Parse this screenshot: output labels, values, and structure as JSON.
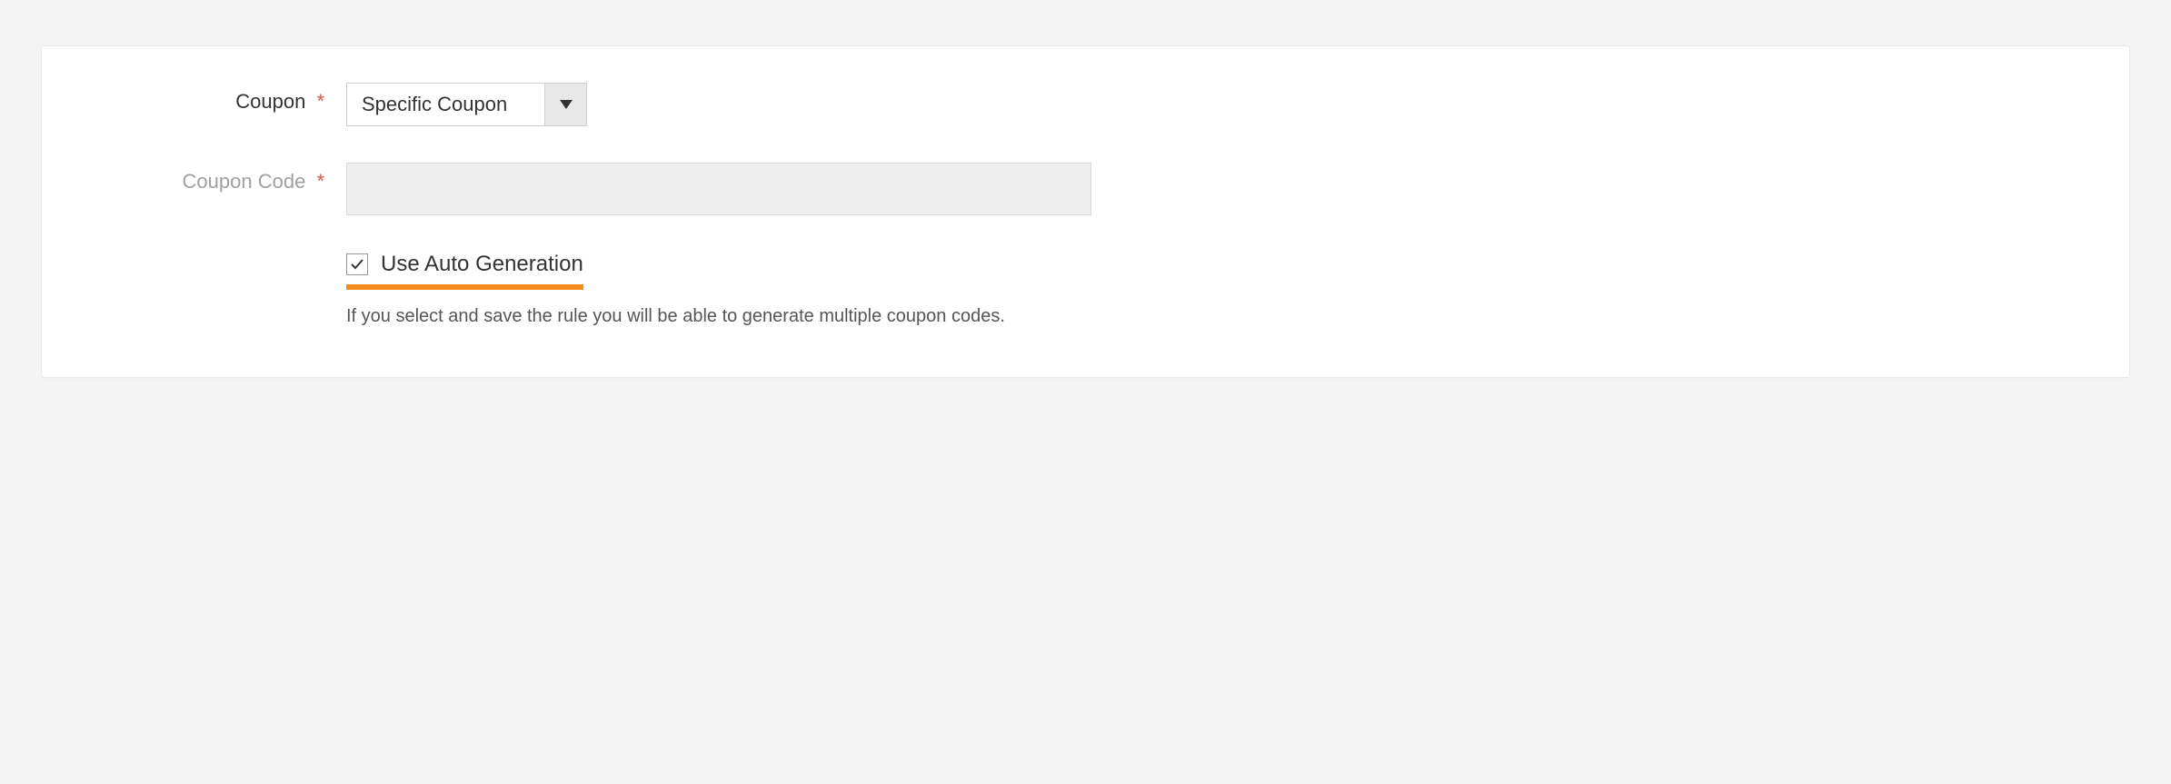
{
  "form": {
    "coupon": {
      "label": "Coupon",
      "required_mark": "*",
      "selected": "Specific Coupon"
    },
    "coupon_code": {
      "label": "Coupon Code",
      "required_mark": "*",
      "value": ""
    },
    "auto_generation": {
      "checked": true,
      "label": "Use Auto Generation",
      "help": "If you select and save the rule you will be able to generate multiple coupon codes."
    }
  },
  "colors": {
    "highlight": "#f28c1f",
    "required": "#d9534f"
  }
}
